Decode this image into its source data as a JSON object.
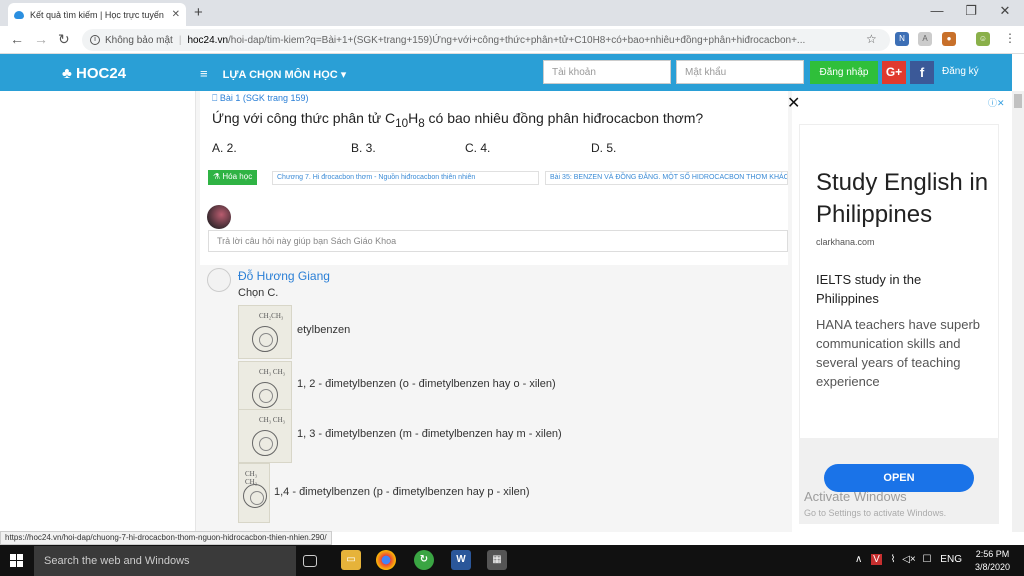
{
  "browser": {
    "tab_title": "Kết quả tìm kiếm | Học trực tuyến",
    "new_tab": "+",
    "url_security": "Không bảo mật",
    "url_host": "hoc24.vn",
    "url_path": "/hoi-dap/tim-kiem?q=Bài+1+(SGK+trang+159)Ứng+với+công+thức+phân+tử+C10H8+có+bao+nhiêu+đồng+phân+hiđrocacbon+..."
  },
  "site": {
    "logo": "HOC24",
    "menu_label": "LỰA CHỌN MÔN HỌC",
    "account_placeholder": "Tài khoản",
    "password_placeholder": "Mật khẩu",
    "login_label": "Đăng nhập",
    "gplus_label": "G+",
    "fb_label": "f",
    "register_label": "Đăng ký"
  },
  "question": {
    "source": "Bài 1 (SGK trang 159)",
    "text_prefix": "Ứng với công thức phân tử C",
    "sub1": "10",
    "text_mid": "H",
    "sub2": "8",
    "text_suffix": " có bao nhiêu đồng phân hiđrocacbon thơm?",
    "options": [
      "A. 2.",
      "B. 3.",
      "C. 4.",
      "D. 5."
    ],
    "subject_tag": "Hóa học",
    "tags": [
      "Chương 7. Hi đrocacbon thơm - Nguồn hiđrocacbon thiên nhiên",
      "Bài 35: BENZEN VÀ ĐỒNG ĐẲNG. MỘT SỐ HIDROCACBON THƠM KHÁC"
    ],
    "reply_placeholder": "Trả lời câu hỏi này giúp bạn Sách Giáo Khoa"
  },
  "answer": {
    "author": "Đỗ Hương Giang",
    "text": "Chọn C.",
    "compounds": [
      {
        "formula": "CH₂CH₃",
        "name": "etylbenzen"
      },
      {
        "formula": "CH₃ CH₃",
        "name": "1, 2 - đimetylbenzen (o - đimetylbenzen hay o - xilen)"
      },
      {
        "formula": "CH₃ CH₃",
        "name": "1, 3 - đimetylbenzen (m - đimetylbenzen hay m - xilen)"
      },
      {
        "formula": "CH₃ CH₃",
        "name": "1,4 - đimetylbenzen (p - đimetylbenzen hay p - xilen)"
      }
    ]
  },
  "ad": {
    "title": "Study English in Philippines",
    "domain": "clarkhana.com",
    "subtitle": "IELTS study in the Philippines",
    "body": "HANA teachers have superb communication skills and several years of teaching experience",
    "open_label": "OPEN"
  },
  "watermark": {
    "line1": "Activate Windows",
    "line2": "Go to Settings to activate Windows."
  },
  "status_url": "https://hoc24.vn/hoi-dap/chuong-7-hi-drocacbon-thom-nguon-hidrocacbon-thien-nhien.290/",
  "taskbar": {
    "search": "Search the web and Windows",
    "lang": "ENG",
    "time": "2:56 PM",
    "date": "3/8/2020"
  },
  "colors": {
    "header": "#2a9fd6",
    "login": "#2fbf3a",
    "gplus": "#e03a2e",
    "facebook": "#3b5998",
    "ad_button": "#1a73e8"
  }
}
